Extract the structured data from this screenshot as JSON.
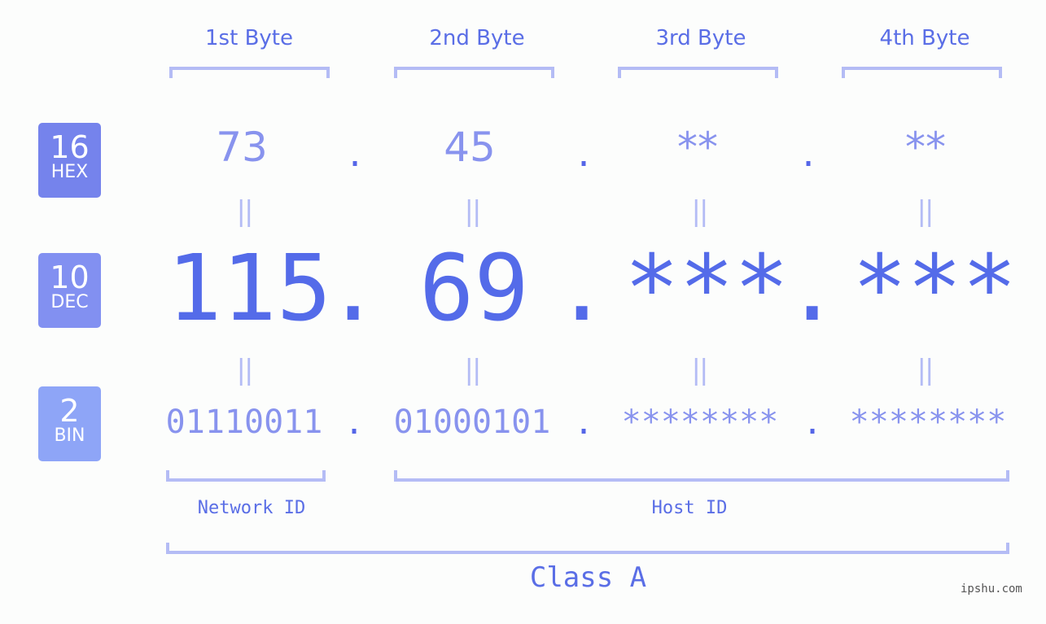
{
  "bytes": [
    {
      "label": "1st Byte",
      "hex": "73",
      "dec": "115",
      "bin": "01110011"
    },
    {
      "label": "2nd Byte",
      "hex": "45",
      "dec": "69",
      "bin": "01000101"
    },
    {
      "label": "3rd Byte",
      "hex": "**",
      "dec": "***",
      "bin": "********"
    },
    {
      "label": "4th Byte",
      "hex": "**",
      "dec": "***",
      "bin": "********"
    }
  ],
  "bases": {
    "hex": {
      "number": "16",
      "label": "HEX",
      "color": "#7583ec"
    },
    "dec": {
      "number": "10",
      "label": "DEC",
      "color": "#8290f1"
    },
    "bin": {
      "number": "2",
      "label": "BIN",
      "color": "#8ea5f7"
    }
  },
  "separator": ".",
  "equals": "||",
  "network_id_label": "Network ID",
  "host_id_label": "Host ID",
  "class_label": "Class A",
  "watermark": "ipshu.com",
  "colors": {
    "primary": "#546be9",
    "secondary": "#8893ee",
    "bracket": "#b4bcf5",
    "background": "#fcfdfc"
  }
}
